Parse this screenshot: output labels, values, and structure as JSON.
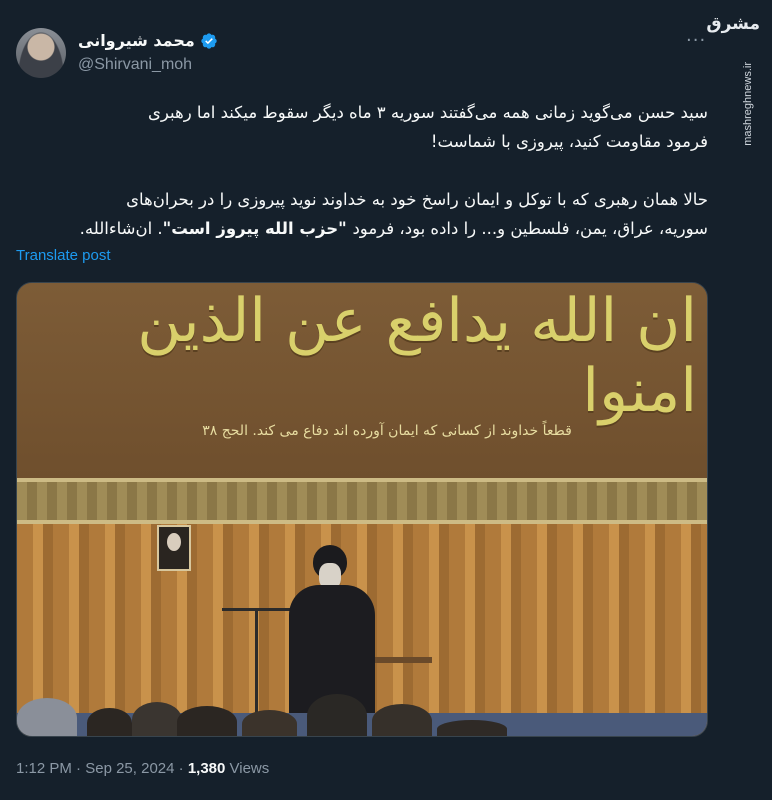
{
  "author": {
    "display_name": "محمد شیروانی",
    "handle": "@Shirvani_moh",
    "verified_icon": "verified-badge-icon",
    "avatar_icon": "user-avatar"
  },
  "more_label": "···",
  "watermark": {
    "logo_text": "مشرق",
    "url": "mashreghnews.ir"
  },
  "tweet": {
    "paragraph1_line1": "سید حسن می‌گوید زمانی همه می‌گفتند سوریه ۳ ماه دیگر سقوط میکند اما رهبری",
    "paragraph1_line2": "فرمود مقاومت کنید، پیروزی با شماست!",
    "paragraph2_line1": "حالا همان رهبری که با توکل و ایمان راسخ خود به خداوند نوید پیروزی را در بحران‌های",
    "paragraph2_line2_start": "سوریه، عراق، یمن، فلسطین و... را داده بود، فرمود",
    "paragraph2_line2_quote": " \"حزب الله پیروز است\"",
    "paragraph2_line2_end": ". ان‌شاءالله."
  },
  "translate_label": "Translate post",
  "media": {
    "calligraphy_text": "ان الله یدافع عن الذین امنوا",
    "subline_text": "قطعاً خداوند از کسانی که ایمان آورده اند دفاع می کند. الحج ۳۸"
  },
  "footer": {
    "time": "1:12 PM",
    "sep1": " · ",
    "date": "Sep 25, 2024",
    "sep2": " · ",
    "views_count": "1,380",
    "views_label": " Views"
  },
  "colors": {
    "background": "#15202b",
    "accent": "#1d9bf0",
    "secondary_text": "#8b98a5"
  }
}
